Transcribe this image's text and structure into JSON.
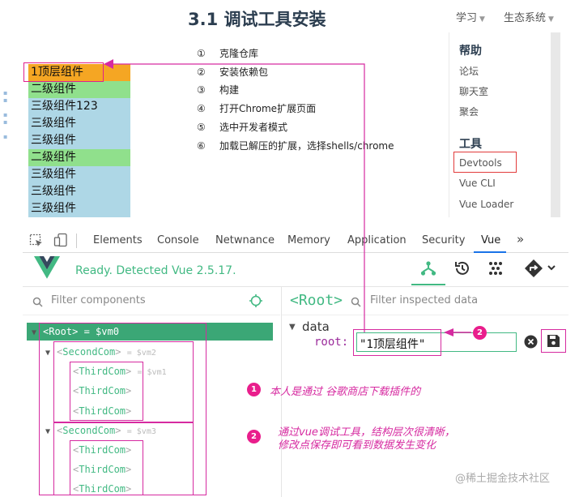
{
  "page": {
    "title": "3.1 调试工具安装",
    "nav": [
      {
        "label": "学习"
      },
      {
        "label": "生态系统"
      }
    ]
  },
  "sidebar": {
    "help_heading": "帮助",
    "help_links": [
      "论坛",
      "聊天室",
      "聚会"
    ],
    "tools_heading": "工具",
    "tools_links": [
      "Devtools",
      "Vue CLI",
      "Vue Loader"
    ]
  },
  "demo_tree": [
    {
      "label": "1顶层组件",
      "color": "#f5a623"
    },
    {
      "label": "二级组件",
      "color": "#90e08c"
    },
    {
      "label": "三级组件123",
      "color": "#aed7e6"
    },
    {
      "label": "三级组件",
      "color": "#aed7e6"
    },
    {
      "label": "三级组件",
      "color": "#aed7e6"
    },
    {
      "label": "二级组件",
      "color": "#90e08c"
    },
    {
      "label": "三级组件",
      "color": "#aed7e6"
    },
    {
      "label": "三级组件",
      "color": "#aed7e6"
    },
    {
      "label": "三级组件",
      "color": "#aed7e6"
    }
  ],
  "steps": [
    {
      "num": "①",
      "text": "克隆仓库"
    },
    {
      "num": "②",
      "text": "安装依赖包"
    },
    {
      "num": "③",
      "text": "构建"
    },
    {
      "num": "④",
      "text": "打开Chrome扩展页面"
    },
    {
      "num": "⑤",
      "text": "选中开发者模式"
    },
    {
      "num": "⑥",
      "text": "加载已解压的扩展，选择shells/chrome"
    }
  ],
  "devtools": {
    "tabs": [
      "Elements",
      "Console",
      "Netwnance",
      "Memory",
      "Application",
      "Security",
      "Vue"
    ],
    "more": "»",
    "active_tab": "Vue",
    "status": "Ready. Detected Vue 2.5.17.",
    "filter_components_placeholder": "Filter components",
    "filter_inspected_placeholder": "Filter inspected data",
    "component_tree": {
      "root": {
        "name": "Root",
        "vm": "= $vm0"
      },
      "children": [
        {
          "name": "SecondCom",
          "vm": "= $vm2",
          "children": [
            {
              "name": "ThirdCom",
              "vm": "= $vm1"
            },
            {
              "name": "ThirdCom",
              "vm": ""
            },
            {
              "name": "ThirdCom",
              "vm": ""
            }
          ]
        },
        {
          "name": "SecondCom",
          "vm": "= $vm3",
          "children": [
            {
              "name": "ThirdCom",
              "vm": ""
            },
            {
              "name": "ThirdCom",
              "vm": ""
            },
            {
              "name": "ThirdCom",
              "vm": ""
            }
          ]
        }
      ]
    },
    "inspector": {
      "selected": "<Root>",
      "section": "data",
      "key": "root:",
      "value": "\"1顶层组件\""
    }
  },
  "annotations": {
    "badge1": "1",
    "badge2": "2",
    "note1": "本人是通过 谷歌商店下载插件的",
    "note2_line1": "通过vue调试工具，结构层次很清晰，",
    "note2_line2": "修改点保存即可看到数据发生变化"
  },
  "watermark": "@稀土掘金技术社区",
  "colors": {
    "vue_green": "#42b983",
    "highlight_magenta": "#d62aa0",
    "root_row": "#3ba776"
  }
}
